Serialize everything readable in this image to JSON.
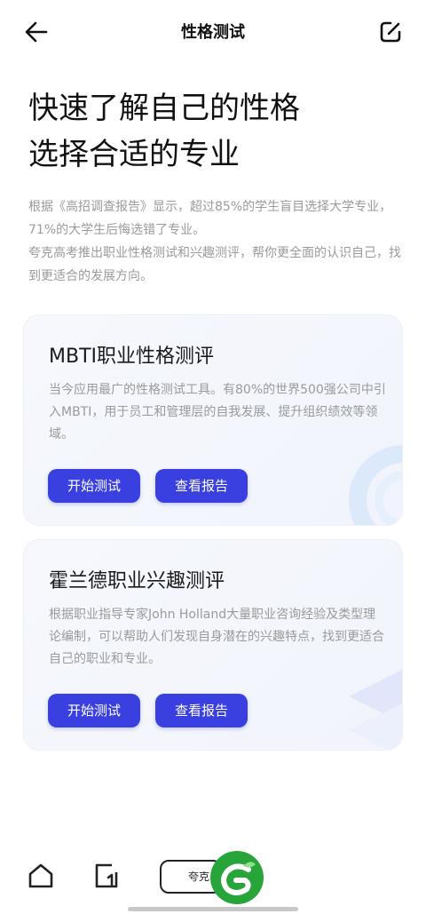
{
  "header": {
    "title": "性格测试"
  },
  "hero": {
    "line1": "快速了解自己的性格",
    "line2": "选择合适的专业"
  },
  "intro": {
    "para1": "根据《高招调查报告》显示，超过85%的学生盲目选择大学专业，71%的大学生后悔选错了专业。",
    "para2": "夸克高考推出职业性格测试和兴趣测评，帮你更全面的认识自己，找到更适合的发展方向。"
  },
  "cards": [
    {
      "title": "MBTI职业性格测评",
      "desc": "当今应用最广的性格测试工具。有80%的世界500强公司中引入MBTI，用于员工和管理层的自我发展、提升组织绩效等领域。",
      "start_label": "开始测试",
      "report_label": "查看报告"
    },
    {
      "title": "霍兰德职业兴趣测评",
      "desc": "根据职业指导专家John Holland大量职业咨询经验及类型理论编制，可以帮助人们发现自身潜在的兴趣特点，找到更适合自己的职业和专业。",
      "start_label": "开始测试",
      "report_label": "查看报告"
    }
  ],
  "bottom_nav": {
    "pill_label": "夸克"
  },
  "colors": {
    "accent": "#3a3fe0",
    "logo_green": "#27a43a",
    "muted_text": "#9a9a9a"
  },
  "icons": {
    "back": "arrow-left-icon",
    "edit": "edit-icon",
    "home": "home-icon",
    "doc": "document-icon",
    "logo": "app-logo-icon"
  }
}
